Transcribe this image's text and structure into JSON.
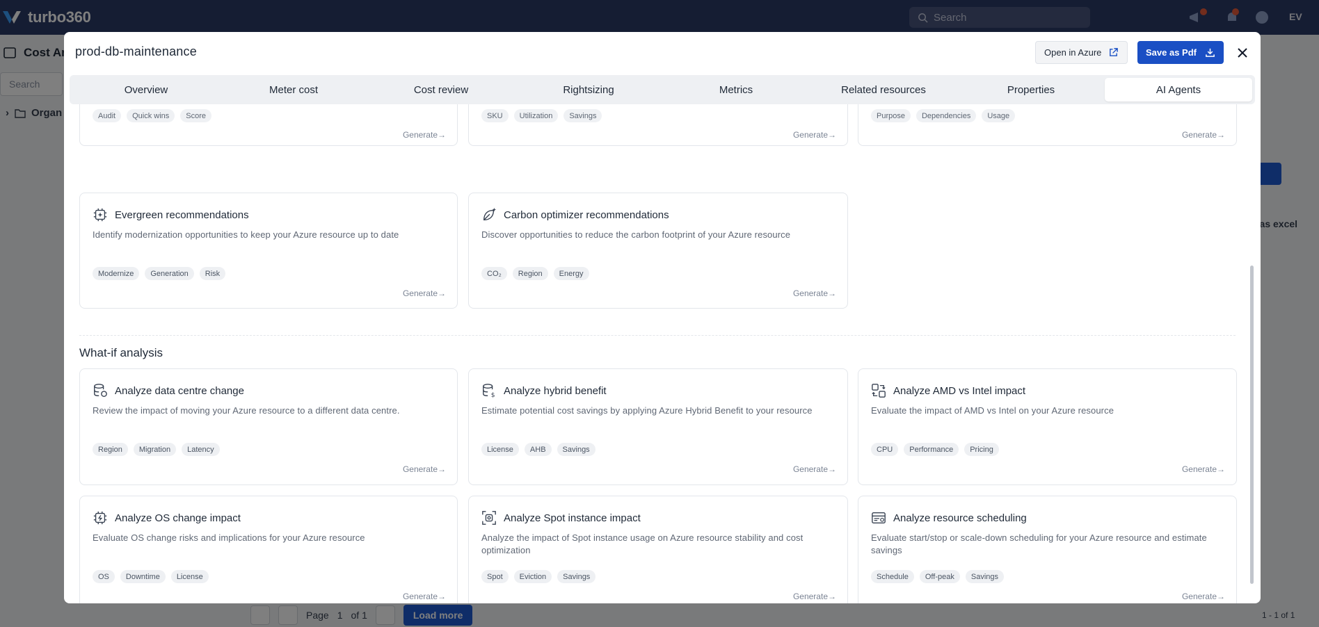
{
  "app": {
    "brand": "turbo360",
    "search_placeholder": "Search",
    "user_initials": "EV"
  },
  "background": {
    "page_title": "Cost An",
    "search_placeholder": "Search",
    "tree_item": "Organ",
    "right_text": "t as excel",
    "pager": {
      "page_label": "Page",
      "page_value": "1",
      "of_label": "of 1",
      "load_more": "Load more"
    },
    "footer_text": "1 - 1 of 1"
  },
  "modal": {
    "title": "prod-db-maintenance",
    "open_in_azure": "Open in Azure",
    "save_as_pdf": "Save as Pdf",
    "tabs": [
      "Overview",
      "Meter cost",
      "Cost review",
      "Rightsizing",
      "Metrics",
      "Related resources",
      "Properties",
      "AI Agents"
    ],
    "active_tab": "AI Agents",
    "generate_label": "Generate→",
    "partial_cards": [
      {
        "tags": [
          "Audit",
          "Quick wins",
          "Score"
        ]
      },
      {
        "tags": [
          "SKU",
          "Utilization",
          "Savings"
        ]
      },
      {
        "tags": [
          "Purpose",
          "Dependencies",
          "Usage"
        ]
      }
    ],
    "recommendation_cards": [
      {
        "icon": "chip-sparkle-icon",
        "title": "Evergreen recommendations",
        "description": "Identify modernization opportunities to keep your Azure resource up to date",
        "tags": [
          "Modernize",
          "Generation",
          "Risk"
        ]
      },
      {
        "icon": "leaf-sparkle-icon",
        "title": "Carbon optimizer recommendations",
        "description": "Discover opportunities to reduce the carbon footprint of your Azure resource",
        "tags": [
          "CO₂",
          "Region",
          "Energy"
        ]
      }
    ],
    "whatif": {
      "title": "What-if analysis",
      "cards": [
        {
          "icon": "database-location-icon",
          "title": "Analyze data centre change",
          "description": "Review the impact of moving your Azure resource to a different data centre.",
          "tags": [
            "Region",
            "Migration",
            "Latency"
          ]
        },
        {
          "icon": "database-dollar-icon",
          "title": "Analyze hybrid benefit",
          "description": "Estimate potential cost savings by applying Azure Hybrid Benefit to your resource",
          "tags": [
            "License",
            "AHB",
            "Savings"
          ]
        },
        {
          "icon": "chip-swap-icon",
          "title": "Analyze AMD vs Intel impact",
          "description": "Evaluate the impact of AMD vs Intel on your Azure resource",
          "tags": [
            "CPU",
            "Performance",
            "Pricing"
          ]
        },
        {
          "icon": "chip-refresh-icon",
          "title": "Analyze OS change impact",
          "description": "Evaluate OS change risks and implications for your Azure resource",
          "tags": [
            "OS",
            "Downtime",
            "License"
          ]
        },
        {
          "icon": "spot-frame-icon",
          "title": "Analyze Spot instance impact",
          "description": "Analyze the impact of Spot instance usage on Azure resource stability and cost optimization",
          "tags": [
            "Spot",
            "Eviction",
            "Savings"
          ]
        },
        {
          "icon": "schedule-window-icon",
          "title": "Analyze resource scheduling",
          "description": "Evaluate start/stop or scale-down scheduling for your Azure resource and estimate savings",
          "tags": [
            "Schedule",
            "Off-peak",
            "Savings"
          ]
        }
      ]
    }
  }
}
